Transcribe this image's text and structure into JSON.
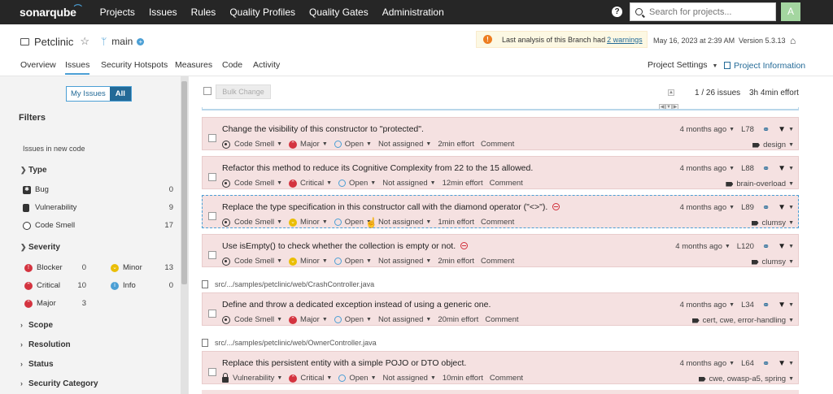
{
  "app": {
    "logo": "sonarqube",
    "nav": [
      "Projects",
      "Issues",
      "Rules",
      "Quality Profiles",
      "Quality Gates",
      "Administration"
    ],
    "help_icon": "question-icon",
    "search_placeholder": "Search for projects...",
    "avatar_letter": "A"
  },
  "project": {
    "name": "Petclinic",
    "branch": "main",
    "warning_prefix": "Last analysis of this Branch had",
    "warning_link": "2 warnings",
    "analysis_date": "May 16, 2023 at 2:39 AM",
    "version": "Version 5.3.13"
  },
  "tabs": [
    "Overview",
    "Issues",
    "Security Hotspots",
    "Measures",
    "Code",
    "Activity"
  ],
  "active_tab": "Issues",
  "project_settings": "Project Settings",
  "project_information": "Project Information",
  "sidebar": {
    "my_issues": "My Issues",
    "all": "All",
    "filters_title": "Filters",
    "new_code": "Issues in new code",
    "type_title": "Type",
    "types": [
      {
        "label": "Bug",
        "count": "0"
      },
      {
        "label": "Vulnerability",
        "count": "9"
      },
      {
        "label": "Code Smell",
        "count": "17"
      }
    ],
    "severity_title": "Severity",
    "severities": [
      {
        "label": "Blocker",
        "count": "0"
      },
      {
        "label": "Minor",
        "count": "13"
      },
      {
        "label": "Critical",
        "count": "10"
      },
      {
        "label": "Info",
        "count": "0"
      },
      {
        "label": "Major",
        "count": "3"
      }
    ],
    "collapsed": [
      "Scope",
      "Resolution",
      "Status",
      "Security Category"
    ]
  },
  "toolbar": {
    "bulk_change": "Bulk Change",
    "count": "1 / 26 issues",
    "effort": "3h 4min effort"
  },
  "issues": [
    {
      "msg": "Change the visibility of this constructor to \"protected\".",
      "type": "Code Smell",
      "severity": "Major",
      "status": "Open",
      "assignee": "Not assigned",
      "effort": "2min effort",
      "comment": "Comment",
      "age": "4 months ago",
      "line": "L78",
      "tags": "design",
      "nogo": false
    },
    {
      "msg": "Refactor this method to reduce its Cognitive Complexity from 22 to the 15 allowed.",
      "type": "Code Smell",
      "severity": "Critical",
      "status": "Open",
      "assignee": "Not assigned",
      "effort": "12min effort",
      "comment": "Comment",
      "age": "4 months ago",
      "line": "L88",
      "tags": "brain-overload",
      "nogo": false
    },
    {
      "msg": "Replace the type specification in this constructor call with the diamond operator (\"<>\").",
      "type": "Code Smell",
      "severity": "Minor",
      "status": "Open",
      "assignee": "Not assigned",
      "effort": "1min effort",
      "comment": "Comment",
      "age": "4 months ago",
      "line": "L89",
      "tags": "clumsy",
      "nogo": true
    },
    {
      "msg": "Use isEmpty() to check whether the collection is empty or not.",
      "type": "Code Smell",
      "severity": "Minor",
      "status": "Open",
      "assignee": "Not assigned",
      "effort": "2min effort",
      "comment": "Comment",
      "age": "4 months ago",
      "line": "L120",
      "tags": "clumsy",
      "nogo": true
    },
    {
      "msg": "Define and throw a dedicated exception instead of using a generic one.",
      "type": "Code Smell",
      "severity": "Major",
      "status": "Open",
      "assignee": "Not assigned",
      "effort": "20min effort",
      "comment": "Comment",
      "age": "4 months ago",
      "line": "L34",
      "tags": "cert, cwe, error-handling",
      "nogo": false
    },
    {
      "msg": "Replace this persistent entity with a simple POJO or DTO object.",
      "type": "Vulnerability",
      "severity": "Critical",
      "status": "Open",
      "assignee": "Not assigned",
      "effort": "10min effort",
      "comment": "Comment",
      "age": "4 months ago",
      "line": "L64",
      "tags": "cwe, owasp-a5, spring",
      "nogo": false
    }
  ],
  "files": [
    "src/.../samples/petclinic/web/CrashController.java",
    "src/.../samples/petclinic/web/OwnerController.java"
  ]
}
